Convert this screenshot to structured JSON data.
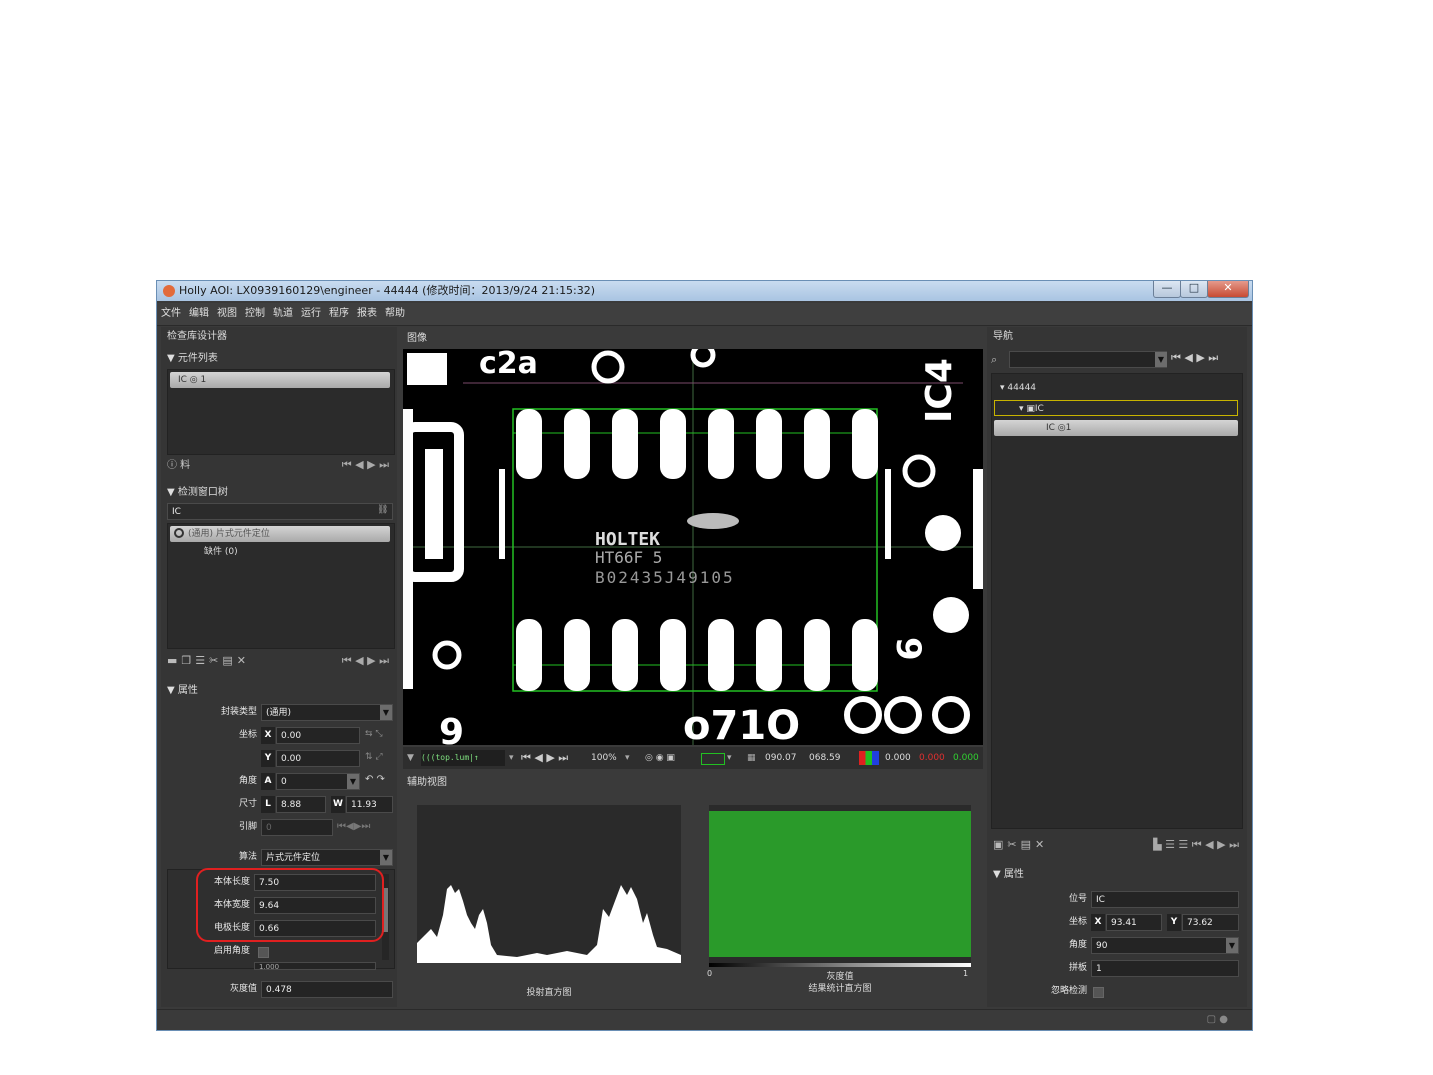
{
  "window": {
    "title": "Holly AOI: LX0939160129\\engineer - 44444 (修改时间：2013/9/24 21:15:32)",
    "controls": {
      "minimize": "—",
      "maximize": "□",
      "close": "✕"
    }
  },
  "menu": [
    "文件",
    "编辑",
    "视图",
    "控制",
    "轨道",
    "运行",
    "程序",
    "报表",
    "帮助"
  ],
  "left_panel": {
    "title": "检查库设计器",
    "component_list": {
      "header": "▼ 元件列表",
      "items": [
        {
          "label": "IC  ◎ 1"
        }
      ],
      "footer_label": "ⓘ 料"
    },
    "detection_window": {
      "header": "▼ 检测窗口树",
      "name_value": "IC",
      "items": [
        {
          "label": "(通用)  片式元件定位"
        },
        {
          "label": "缺件  (0)"
        }
      ]
    },
    "properties": {
      "header": "▼ 属性",
      "rows": {
        "pkg_type": {
          "label": "封装类型",
          "value": "(通用)"
        },
        "coord": {
          "label": "坐标",
          "x_tag": "X",
          "x": "0.00",
          "y_tag": "Y",
          "y": "0.00"
        },
        "angle": {
          "label": "角度",
          "tag": "A",
          "value": "0"
        },
        "size": {
          "label": "尺寸",
          "l_tag": "L",
          "l": "8.88",
          "w_tag": "W",
          "w": "11.93"
        },
        "pin": {
          "label": "引脚",
          "value": "0"
        },
        "algorithm": {
          "label": "算法",
          "value": "片式元件定位"
        },
        "body_length": {
          "label": "本体长度",
          "value": "7.50"
        },
        "body_width": {
          "label": "本体宽度",
          "value": "9.64"
        },
        "electrode_length": {
          "label": "电极长度",
          "value": "0.66"
        },
        "enable_angle": {
          "label": "启用角度"
        },
        "partial_value": "1.000",
        "gray": {
          "label": "灰度值",
          "value": "0.478"
        }
      }
    }
  },
  "image_panel": {
    "title": "图像",
    "toolbar": {
      "channel": "(((top.lum|↑",
      "zoom": "100%",
      "x": "090.07",
      "y": "068.59",
      "v1": "0.000",
      "v2": "0.000",
      "v3": "0.000"
    }
  },
  "aux_panel": {
    "title": "辅助视图",
    "left_caption": "投射直方图",
    "right_axis_min": "0",
    "right_axis_label": "灰度值",
    "right_axis_max": "1",
    "right_caption": "结果统计直方图",
    "colors": {
      "bar": "#2a9a2a"
    }
  },
  "nav_panel": {
    "title": "导航",
    "tree": {
      "root": "44444",
      "child": "IC",
      "leaf": "IC ◎1"
    },
    "properties": {
      "header": "▼ 属性",
      "refdes": {
        "label": "位号",
        "value": "IC"
      },
      "coord": {
        "label": "坐标",
        "x_tag": "X",
        "x": "93.41",
        "y_tag": "Y",
        "y": "73.62"
      },
      "angle": {
        "label": "角度",
        "value": "90"
      },
      "board": {
        "label": "拼板",
        "value": "1"
      },
      "ignore": {
        "label": "忽略检测"
      }
    }
  },
  "pcb_text": {
    "silk1": "HOLTEK",
    "silk2": "HT66F 5",
    "silk3": "B02435J49105"
  }
}
